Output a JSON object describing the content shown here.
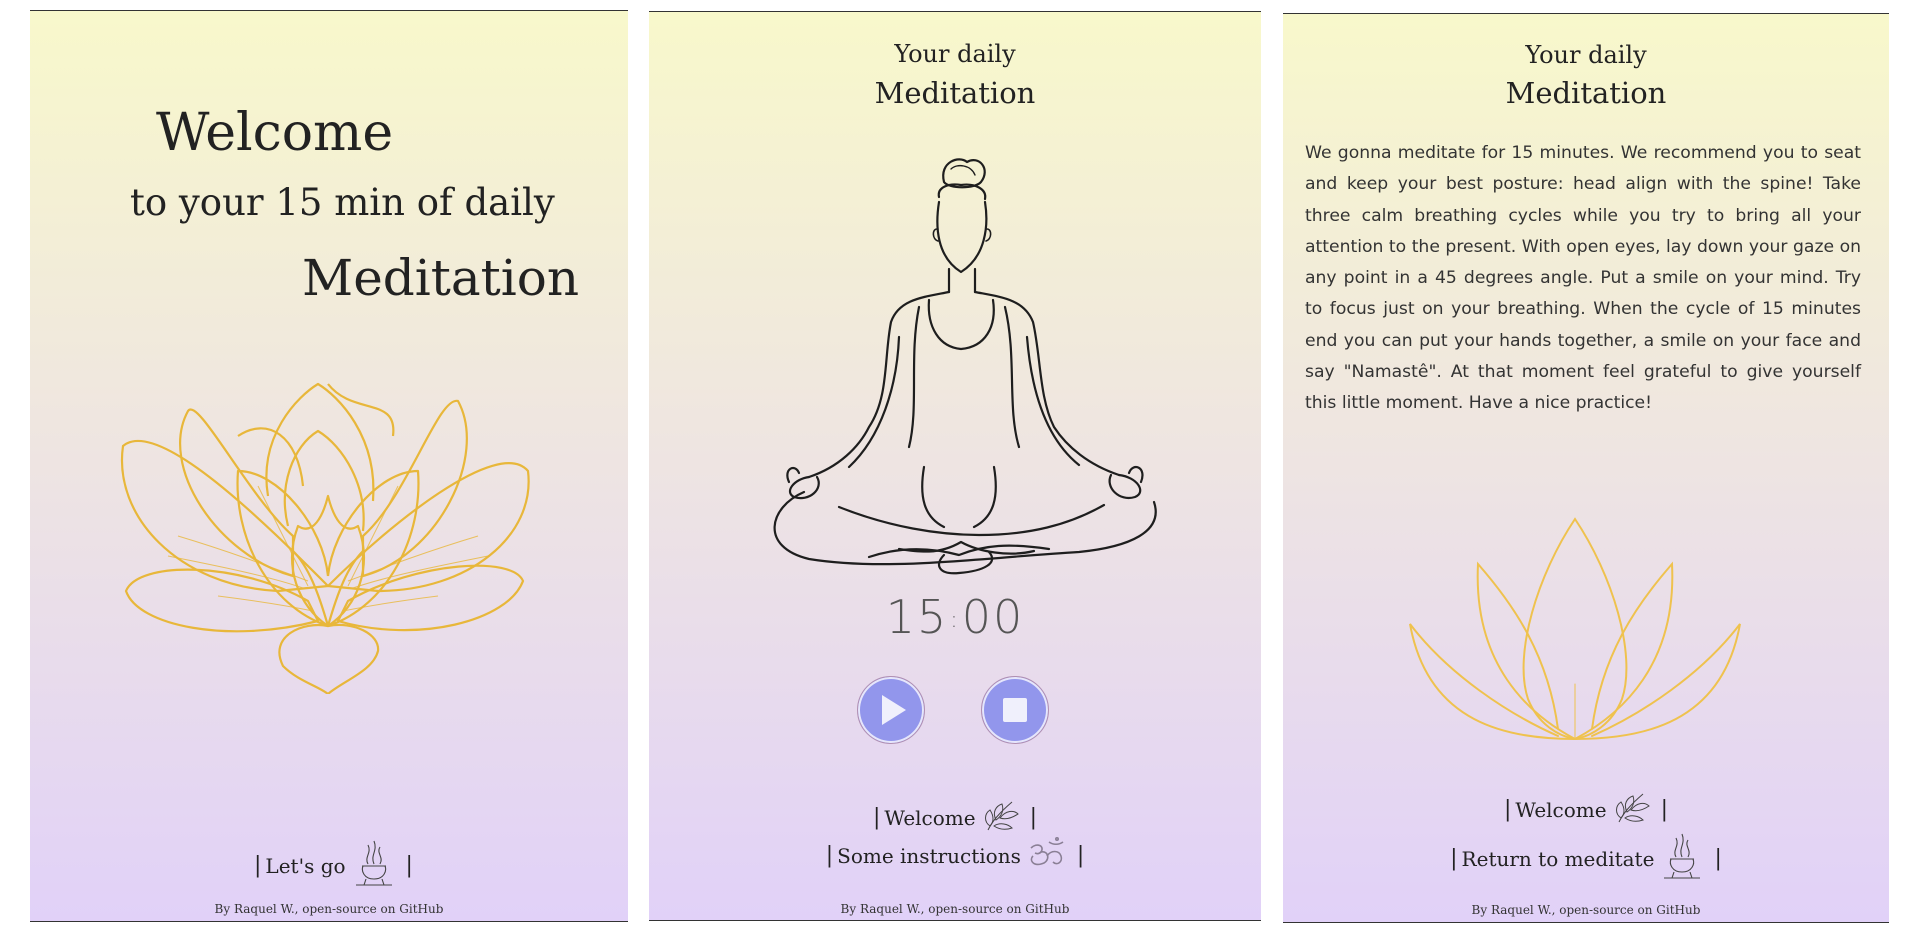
{
  "welcome_screen": {
    "title": "Welcome",
    "subtitle": "to your 15 min of daily",
    "heading": "Meditation",
    "nav": {
      "lets_go": "Let's go",
      "separator": "|"
    },
    "footer": "By Raquel W., open-source on GitHub",
    "icons": [
      "lotus-icon",
      "incense-icon"
    ],
    "accent_color": "#e8b73a"
  },
  "timer_screen": {
    "title_line1": "Your daily",
    "title_line2": "Meditation",
    "timer": {
      "minutes": "15",
      "colon": ":",
      "seconds": "00"
    },
    "controls": {
      "play": "play",
      "stop": "stop"
    },
    "nav": {
      "welcome": "Welcome",
      "instructions": "Some instructions",
      "separator": "|"
    },
    "footer": "By Raquel W., open-source on GitHub",
    "icons": [
      "meditating-person-icon",
      "play-icon",
      "stop-icon",
      "leaves-icon",
      "om-icon"
    ],
    "button_color": "#9296ec"
  },
  "instructions_screen": {
    "title_line1": "Your daily",
    "title_line2": "Meditation",
    "body": "We gonna meditate for 15 minutes. We recommend you to seat and keep your best posture: head align with the spine! Take three calm breathing cycles while you try to bring all your attention to the present. With open eyes, lay down your gaze on any point in a 45 degrees angle. Put a smile on your mind. Try to focus just on your breathing. When the cycle of 15 minutes end you can put your hands together, a smile on your face and say \"Namastê\". At that moment feel grateful to give yourself this little moment. Have a nice practice!",
    "nav": {
      "welcome": "Welcome",
      "return": "Return to meditate",
      "separator": "|"
    },
    "footer": "By Raquel W., open-source on GitHub",
    "icons": [
      "lotus-outline-icon",
      "leaves-icon",
      "incense-icon"
    ]
  }
}
